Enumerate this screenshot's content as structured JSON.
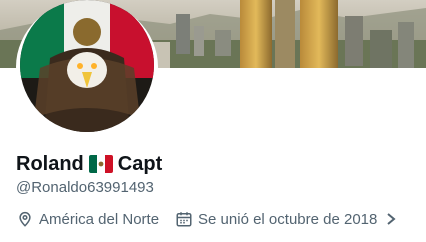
{
  "profile": {
    "name_part1": "Roland",
    "name_part2": "Capt",
    "flag_icon": "mexico-flag-icon",
    "handle": "@Ronaldo63991493",
    "location": "América del Norte",
    "joined": "Se unió el octubre de 2018"
  },
  "icons": {
    "location": "location-pin-icon",
    "calendar": "calendar-icon",
    "chevron": "chevron-right-icon"
  },
  "colors": {
    "text_primary": "#0f1419",
    "text_secondary": "#536471",
    "flag_green": "#006847",
    "flag_red": "#ce1126"
  }
}
